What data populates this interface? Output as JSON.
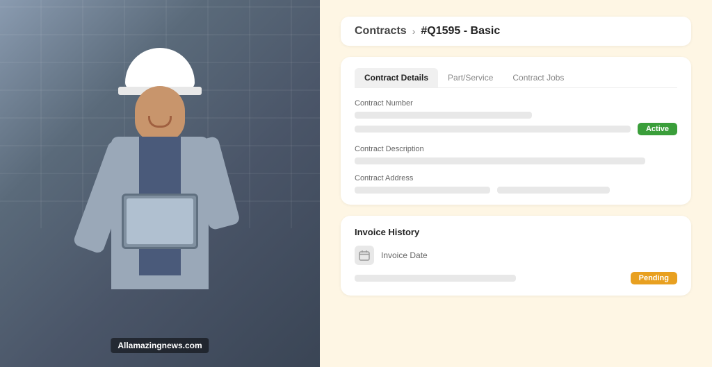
{
  "left": {
    "watermark": "Allamazingnews.com"
  },
  "breadcrumb": {
    "contracts_label": "Contracts",
    "chevron": "›",
    "current": "#Q1595 - Basic"
  },
  "contract_card": {
    "tabs": [
      {
        "id": "contract-details",
        "label": "Contract Details",
        "active": true
      },
      {
        "id": "part-service",
        "label": "Part/Service",
        "active": false
      },
      {
        "id": "contract-jobs",
        "label": "Contract Jobs",
        "active": false
      }
    ],
    "contract_number_label": "Contract Number",
    "contract_description_label": "Contract Description",
    "contract_address_label": "Contract Address",
    "status_badge": "Active"
  },
  "invoice_card": {
    "title": "Invoice History",
    "invoice_date_label": "Invoice Date",
    "status_badge": "Pending"
  }
}
